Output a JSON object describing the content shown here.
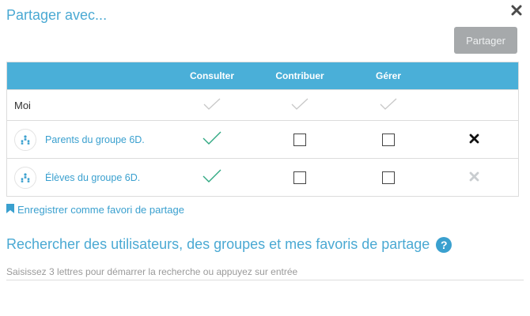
{
  "dialog": {
    "title": "Partager avec...",
    "share_button": "Partager"
  },
  "table": {
    "headers": {
      "consult": "Consulter",
      "contribute": "Contribuer",
      "manage": "Gérer"
    },
    "rows": [
      {
        "name": "Moi",
        "type": "user",
        "consult": true,
        "contribute": true,
        "manage": true,
        "locked": true
      },
      {
        "name": "Parents du groupe 6D.",
        "type": "group",
        "icon": "group-icon",
        "consult": true,
        "contribute": false,
        "manage": false,
        "remove_enabled": true
      },
      {
        "name": "Élèves du groupe 6D.",
        "type": "group",
        "icon": "group-icon",
        "consult": true,
        "contribute": false,
        "manage": false,
        "remove_enabled": false
      }
    ]
  },
  "favorite_link": "Enregistrer comme favori de partage",
  "search": {
    "title": "Rechercher des utilisateurs, des groupes et mes favoris de partage",
    "help_icon": "?",
    "placeholder": "Saisissez 3 lettres pour démarrer la recherche ou appuyez sur entrée",
    "value": ""
  },
  "colors": {
    "accent": "#4aafd8",
    "link": "#3aa0cf",
    "check_active": "#2fa882",
    "check_locked": "#c7c7c7",
    "button_disabled": "#a6a9ab"
  }
}
